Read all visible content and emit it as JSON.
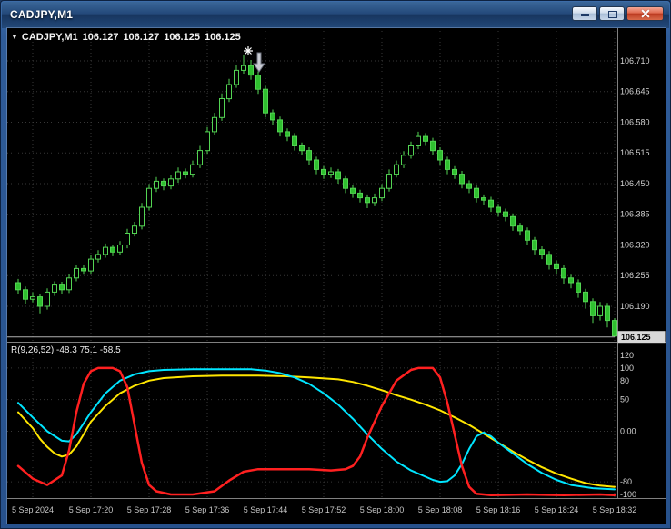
{
  "window": {
    "title": "CADJPY,M1"
  },
  "icons": {
    "symbol_dropdown": "▼"
  },
  "quote_bar": {
    "symbol": "CADJPY,M1",
    "open": "106.127",
    "high": "106.127",
    "low": "106.125",
    "close": "106.125"
  },
  "price_axis": {
    "current_price": "106.125"
  },
  "indicator_panel": {
    "label": "R(9,26,52) -48.3 75.1 -58.5",
    "axis_labels": [
      "120",
      "100",
      "80",
      "50",
      "0.00",
      "-80",
      "-100"
    ],
    "level_lines": [
      100,
      50,
      0,
      -80
    ]
  },
  "time_axis": {
    "labels": [
      {
        "text": "5 Sep 2024",
        "index": 2
      },
      {
        "text": "5 Sep 17:20",
        "index": 10
      },
      {
        "text": "5 Sep 17:28",
        "index": 18
      },
      {
        "text": "5 Sep 17:36",
        "index": 26
      },
      {
        "text": "5 Sep 17:44",
        "index": 34
      },
      {
        "text": "5 Sep 17:52",
        "index": 42
      },
      {
        "text": "5 Sep 18:00",
        "index": 50
      },
      {
        "text": "5 Sep 18:08",
        "index": 58
      },
      {
        "text": "5 Sep 18:16",
        "index": 66
      },
      {
        "text": "5 Sep 18:24",
        "index": 74
      },
      {
        "text": "5 Sep 18:32",
        "index": 82
      }
    ]
  },
  "colors": {
    "background": "#000000",
    "grid": "#373737",
    "candle_outline": "#53d453",
    "bull_body": "#000000",
    "bear_body": "#2fbf2f",
    "bid_line": "#b0b0b0",
    "price_box_bg": "#d8d8d8",
    "red_line": "#ff2020",
    "aqua_line": "#00e5ff",
    "yellow_line": "#ffe600"
  },
  "chart_data": [
    {
      "type": "candlestick",
      "symbol": "CADJPY",
      "timeframe": "M1",
      "interval_minutes": 1,
      "first_bar_time": "5 Sep 17:10",
      "y_ticks": [
        "106.710",
        "106.645",
        "106.580",
        "106.515",
        "106.450",
        "106.385",
        "106.320",
        "106.255",
        "106.190"
      ],
      "ylim": [
        106.115,
        106.775
      ],
      "bid": 106.125,
      "ohlc": [
        [
          106.24,
          106.248,
          106.215,
          106.225
        ],
        [
          106.225,
          106.232,
          106.195,
          106.205
        ],
        [
          106.205,
          106.22,
          106.198,
          106.21
        ],
        [
          106.21,
          106.216,
          106.175,
          106.19
        ],
        [
          106.19,
          106.228,
          106.183,
          106.22
        ],
        [
          106.22,
          106.243,
          106.212,
          106.235
        ],
        [
          106.235,
          106.242,
          106.216,
          106.225
        ],
        [
          106.225,
          106.258,
          106.218,
          106.25
        ],
        [
          106.25,
          106.278,
          106.243,
          106.27
        ],
        [
          106.27,
          106.277,
          106.257,
          106.265
        ],
        [
          106.265,
          106.298,
          106.258,
          106.29
        ],
        [
          106.29,
          106.309,
          106.283,
          106.3
        ],
        [
          106.3,
          106.323,
          106.293,
          106.315
        ],
        [
          106.315,
          106.321,
          106.296,
          106.305
        ],
        [
          106.305,
          106.328,
          106.298,
          106.32
        ],
        [
          106.32,
          106.354,
          106.313,
          106.345
        ],
        [
          106.345,
          106.369,
          106.338,
          106.36
        ],
        [
          106.36,
          106.409,
          106.353,
          106.4
        ],
        [
          106.4,
          106.449,
          106.393,
          106.44
        ],
        [
          106.44,
          106.464,
          106.432,
          106.455
        ],
        [
          106.455,
          106.461,
          106.436,
          106.445
        ],
        [
          106.445,
          106.469,
          106.438,
          106.46
        ],
        [
          106.46,
          106.484,
          106.452,
          106.475
        ],
        [
          106.475,
          106.482,
          106.461,
          106.47
        ],
        [
          106.47,
          106.499,
          106.463,
          106.49
        ],
        [
          106.49,
          106.53,
          106.483,
          106.52
        ],
        [
          106.52,
          106.57,
          106.513,
          106.56
        ],
        [
          106.56,
          106.6,
          106.553,
          106.59
        ],
        [
          106.59,
          106.641,
          106.583,
          106.63
        ],
        [
          106.63,
          106.672,
          106.623,
          106.66
        ],
        [
          106.66,
          106.702,
          106.653,
          106.69
        ],
        [
          106.69,
          106.722,
          106.683,
          106.7
        ],
        [
          106.7,
          106.712,
          106.67,
          106.68
        ],
        [
          106.68,
          106.688,
          106.64,
          106.65
        ],
        [
          106.65,
          106.657,
          106.59,
          106.6
        ],
        [
          106.6,
          106.607,
          106.575,
          106.585
        ],
        [
          106.585,
          106.592,
          106.55,
          106.56
        ],
        [
          106.56,
          106.567,
          106.54,
          106.55
        ],
        [
          106.55,
          106.557,
          106.52,
          106.53
        ],
        [
          106.53,
          106.537,
          106.51,
          106.52
        ],
        [
          106.52,
          106.527,
          106.49,
          106.5
        ],
        [
          106.5,
          106.507,
          106.47,
          106.48
        ],
        [
          106.48,
          106.487,
          106.46,
          106.47
        ],
        [
          106.47,
          106.484,
          106.462,
          106.475
        ],
        [
          106.475,
          106.481,
          106.45,
          106.46
        ],
        [
          106.46,
          106.466,
          106.43,
          106.44
        ],
        [
          106.44,
          106.447,
          106.42,
          106.43
        ],
        [
          106.43,
          106.437,
          106.41,
          106.42
        ],
        [
          106.42,
          106.427,
          106.398,
          106.41
        ],
        [
          106.41,
          106.429,
          106.402,
          106.42
        ],
        [
          106.42,
          106.449,
          106.413,
          106.44
        ],
        [
          106.44,
          106.48,
          106.433,
          106.47
        ],
        [
          106.47,
          106.499,
          106.463,
          106.49
        ],
        [
          106.49,
          106.519,
          106.483,
          106.51
        ],
        [
          106.51,
          106.539,
          106.503,
          106.53
        ],
        [
          106.53,
          106.56,
          106.523,
          106.55
        ],
        [
          106.55,
          106.557,
          106.53,
          106.54
        ],
        [
          106.54,
          106.547,
          106.51,
          106.52
        ],
        [
          106.52,
          106.527,
          106.49,
          106.5
        ],
        [
          106.5,
          106.507,
          106.47,
          106.48
        ],
        [
          106.48,
          106.487,
          106.46,
          106.47
        ],
        [
          106.47,
          106.477,
          106.44,
          106.45
        ],
        [
          106.45,
          106.457,
          106.43,
          106.44
        ],
        [
          106.44,
          106.447,
          106.41,
          106.42
        ],
        [
          106.42,
          106.427,
          106.405,
          106.415
        ],
        [
          106.415,
          106.422,
          106.39,
          106.4
        ],
        [
          106.4,
          106.407,
          106.38,
          106.39
        ],
        [
          106.39,
          106.397,
          106.37,
          106.38
        ],
        [
          106.38,
          106.387,
          106.35,
          106.36
        ],
        [
          106.36,
          106.367,
          106.34,
          106.35
        ],
        [
          106.35,
          106.357,
          106.32,
          106.33
        ],
        [
          106.33,
          106.337,
          106.3,
          106.31
        ],
        [
          106.31,
          106.317,
          106.29,
          106.3
        ],
        [
          106.3,
          106.307,
          106.268,
          106.28
        ],
        [
          106.28,
          106.287,
          106.258,
          106.27
        ],
        [
          106.27,
          106.277,
          106.238,
          106.25
        ],
        [
          106.25,
          106.257,
          106.228,
          106.24
        ],
        [
          106.24,
          106.247,
          106.208,
          106.22
        ],
        [
          106.22,
          106.227,
          106.185,
          106.2
        ],
        [
          106.2,
          106.207,
          106.155,
          106.17
        ],
        [
          106.17,
          106.199,
          106.16,
          106.19
        ],
        [
          106.19,
          106.197,
          106.145,
          106.16
        ],
        [
          106.16,
          106.165,
          106.125,
          106.127
        ]
      ]
    },
    {
      "type": "line",
      "name": "R(9,26,52)",
      "values_text": "-48.3 75.1 -58.5",
      "ylim": [
        -104,
        140
      ],
      "levels": [
        100,
        50,
        0,
        -80
      ],
      "series": [
        {
          "name": "yellow",
          "color": "#ffe600",
          "points": [
            [
              0,
              30
            ],
            [
              2,
              5
            ],
            [
              3,
              -12
            ],
            [
              4,
              -25
            ],
            [
              5,
              -35
            ],
            [
              6,
              -40
            ],
            [
              7,
              -37
            ],
            [
              8,
              -24
            ],
            [
              9,
              -5
            ],
            [
              10,
              15
            ],
            [
              12,
              40
            ],
            [
              14,
              60
            ],
            [
              16,
              72
            ],
            [
              18,
              80
            ],
            [
              20,
              84
            ],
            [
              24,
              87
            ],
            [
              28,
              88
            ],
            [
              33,
              88
            ],
            [
              37,
              87
            ],
            [
              40,
              85
            ],
            [
              44,
              82
            ],
            [
              46,
              78
            ],
            [
              48,
              72
            ],
            [
              50,
              65
            ],
            [
              52,
              57
            ],
            [
              54,
              50
            ],
            [
              56,
              42
            ],
            [
              58,
              33
            ],
            [
              60,
              22
            ],
            [
              62,
              10
            ],
            [
              64,
              -4
            ],
            [
              66,
              -18
            ],
            [
              68,
              -32
            ],
            [
              70,
              -45
            ],
            [
              72,
              -57
            ],
            [
              74,
              -67
            ],
            [
              76,
              -75
            ],
            [
              78,
              -82
            ],
            [
              80,
              -86
            ],
            [
              82,
              -88
            ]
          ]
        },
        {
          "name": "aqua",
          "color": "#00e5ff",
          "points": [
            [
              0,
              45
            ],
            [
              2,
              22
            ],
            [
              4,
              0
            ],
            [
              6,
              -15
            ],
            [
              7,
              -16
            ],
            [
              8,
              -5
            ],
            [
              10,
              30
            ],
            [
              12,
              60
            ],
            [
              14,
              80
            ],
            [
              16,
              90
            ],
            [
              18,
              95
            ],
            [
              20,
              97
            ],
            [
              24,
              98
            ],
            [
              28,
              98
            ],
            [
              32,
              98
            ],
            [
              34,
              96
            ],
            [
              36,
              92
            ],
            [
              38,
              85
            ],
            [
              40,
              75
            ],
            [
              42,
              60
            ],
            [
              44,
              42
            ],
            [
              46,
              20
            ],
            [
              48,
              -5
            ],
            [
              50,
              -28
            ],
            [
              52,
              -48
            ],
            [
              54,
              -62
            ],
            [
              56,
              -72
            ],
            [
              57,
              -77
            ],
            [
              58,
              -80
            ],
            [
              59,
              -79
            ],
            [
              60,
              -70
            ],
            [
              61,
              -52
            ],
            [
              62,
              -28
            ],
            [
              63,
              -8
            ],
            [
              64,
              -2
            ],
            [
              65,
              -8
            ],
            [
              66,
              -18
            ],
            [
              68,
              -35
            ],
            [
              70,
              -52
            ],
            [
              72,
              -66
            ],
            [
              74,
              -77
            ],
            [
              76,
              -85
            ],
            [
              79,
              -90
            ],
            [
              82,
              -92
            ]
          ]
        },
        {
          "name": "red",
          "color": "#ff2020",
          "points": [
            [
              0,
              -55
            ],
            [
              2,
              -75
            ],
            [
              4,
              -85
            ],
            [
              6,
              -70
            ],
            [
              7,
              -30
            ],
            [
              8,
              30
            ],
            [
              9,
              75
            ],
            [
              10,
              95
            ],
            [
              11,
              100
            ],
            [
              13,
              100
            ],
            [
              14,
              95
            ],
            [
              15,
              70
            ],
            [
              16,
              10
            ],
            [
              17,
              -50
            ],
            [
              18,
              -85
            ],
            [
              19,
              -95
            ],
            [
              21,
              -100
            ],
            [
              24,
              -100
            ],
            [
              27,
              -95
            ],
            [
              29,
              -78
            ],
            [
              31,
              -64
            ],
            [
              33,
              -60
            ],
            [
              40,
              -60
            ],
            [
              43,
              -62
            ],
            [
              45,
              -60
            ],
            [
              46,
              -55
            ],
            [
              47,
              -40
            ],
            [
              48,
              -10
            ],
            [
              50,
              40
            ],
            [
              52,
              80
            ],
            [
              54,
              97
            ],
            [
              55,
              100
            ],
            [
              57,
              100
            ],
            [
              58,
              85
            ],
            [
              59,
              45
            ],
            [
              60,
              -5
            ],
            [
              61,
              -55
            ],
            [
              62,
              -88
            ],
            [
              63,
              -99
            ],
            [
              65,
              -101
            ],
            [
              70,
              -100
            ],
            [
              75,
              -101
            ],
            [
              80,
              -100
            ],
            [
              82,
              -101
            ]
          ]
        }
      ]
    }
  ]
}
